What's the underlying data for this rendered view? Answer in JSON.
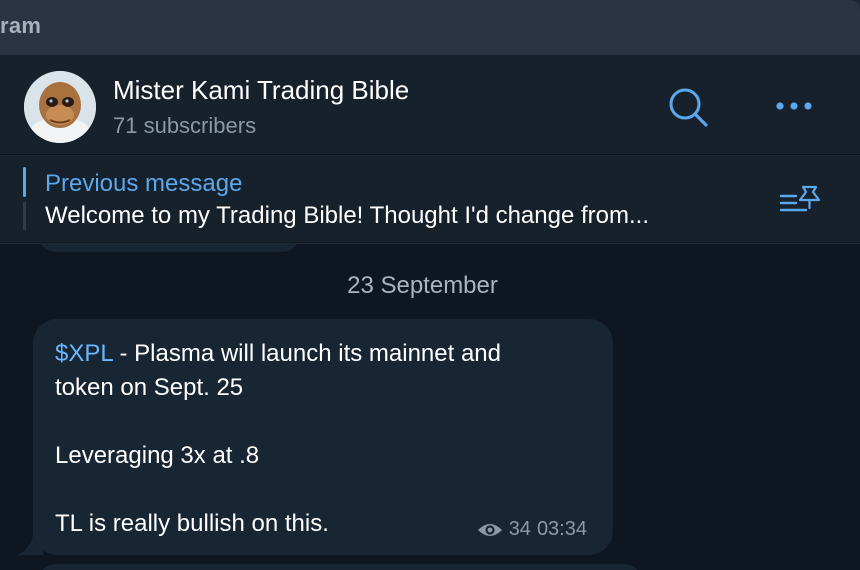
{
  "titlebar": {
    "text": "ram"
  },
  "header": {
    "channel_title": "Mister Kami Trading Bible",
    "subscribers": "71 subscribers",
    "icons": {
      "search": "search-icon",
      "more": "more-dots-icon"
    }
  },
  "pinned": {
    "label": "Previous message",
    "text": "Welcome to my Trading Bible!  Thought I'd change from...",
    "icon": "pinned-list-icon"
  },
  "chat": {
    "date_separator": "23 September",
    "message": {
      "cashtag": "$XPL",
      "line1_rest": " - Plasma will launch its mainnet and",
      "line2": "token on Sept. 25",
      "line3": "Leveraging 3x at .8",
      "line4": "TL is really bullish on this.",
      "views": "34",
      "time": "03:34"
    }
  },
  "colors": {
    "accent": "#5aa8ee",
    "link": "#6ab7ff",
    "chat_background": "#0e1621",
    "bubble": "#182533",
    "header": "#17212b"
  }
}
